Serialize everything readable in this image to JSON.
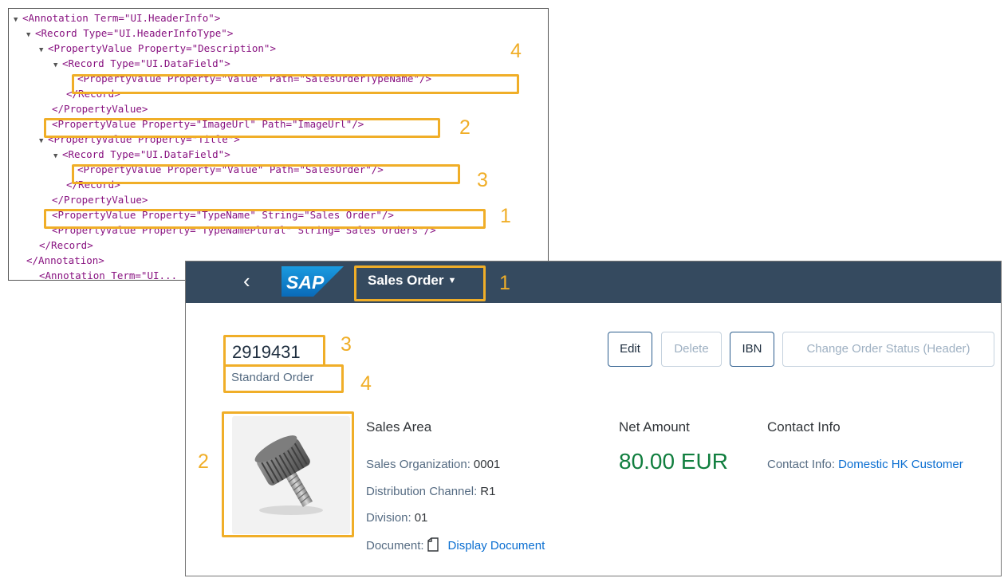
{
  "xml": {
    "lines": [
      {
        "tw": "▼",
        "text": "<Annotation Term=\"UI.HeaderInfo\">"
      },
      {
        "tw": "▼",
        "text": "<Record Type=\"UI.HeaderInfoType\">"
      },
      {
        "tw": "▼",
        "text": "<PropertyValue Property=\"Description\">"
      },
      {
        "tw": "▼",
        "text": "<Record Type=\"UI.DataField\">"
      },
      {
        "tw": "",
        "text": "<PropertyValue Property=\"Value\" Path=\"SalesOrderTypeName\"/>"
      },
      {
        "tw": "",
        "text": "</Record>"
      },
      {
        "tw": "",
        "text": "</PropertyValue>"
      },
      {
        "tw": "",
        "text": "<PropertyValue Property=\"ImageUrl\" Path=\"ImageUrl\"/>"
      },
      {
        "tw": "▼",
        "text": "<PropertyValue Property=\"Title\">"
      },
      {
        "tw": "▼",
        "text": "<Record Type=\"UI.DataField\">"
      },
      {
        "tw": "",
        "text": "<PropertyValue Property=\"Value\" Path=\"SalesOrder\"/>"
      },
      {
        "tw": "",
        "text": "</Record>"
      },
      {
        "tw": "",
        "text": "</PropertyValue>"
      },
      {
        "tw": "",
        "text": "<PropertyValue Property=\"TypeName\" String=\"Sales Order\"/>"
      },
      {
        "tw": "",
        "text": "<PropertyValue Property=\"TypeNamePlural\" String=\"Sales Orders\"/>"
      },
      {
        "tw": "",
        "text": "</Record>"
      },
      {
        "tw": "",
        "text": "</Annotation>"
      },
      {
        "tw": "",
        "text": "<Annotation Term=\"UI..."
      }
    ]
  },
  "callouts": {
    "type_name": "1",
    "image_url": "2",
    "title": "3",
    "description": "4"
  },
  "shell": {
    "back_icon": "‹",
    "logo_text": "SAP",
    "title": "Sales Order",
    "title_caret": "▼"
  },
  "header": {
    "object_id": "2919431",
    "object_description": "Standard Order",
    "actions": {
      "edit": "Edit",
      "delete": "Delete",
      "ibn": "IBN",
      "change_status": "Change Order Status (Header)"
    }
  },
  "sales_area": {
    "title": "Sales Area",
    "org_label": "Sales Organization:",
    "org_value": "0001",
    "channel_label": "Distribution Channel:",
    "channel_value": "R1",
    "division_label": "Division:",
    "division_value": "01",
    "document_label": "Document:",
    "document_link": "Display Document"
  },
  "net_amount": {
    "title": "Net Amount",
    "value": "80.00 EUR"
  },
  "contact": {
    "title": "Contact Info",
    "label": "Contact Info:",
    "link": "Domestic HK Customer"
  },
  "colors": {
    "highlight": "#f0ae28",
    "shell_bar": "#354a5f",
    "amount_positive": "#107e3e",
    "link": "#0a6ed1"
  }
}
